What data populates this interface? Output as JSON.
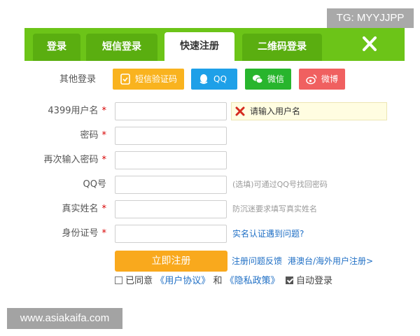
{
  "watermarks": {
    "top": "TG: MYYJJPP",
    "bottom": "www.asiakaifa.com"
  },
  "tabs": [
    {
      "label": "登录",
      "active": false
    },
    {
      "label": "短信登录",
      "active": false
    },
    {
      "label": "快速注册",
      "active": true
    },
    {
      "label": "二维码登录",
      "active": false
    }
  ],
  "close_icon": "close-icon",
  "other_login": {
    "label": "其他登录",
    "buttons": [
      {
        "label": "短信验证码",
        "color": "#f9b31f",
        "icon": "sms-icon"
      },
      {
        "label": "QQ",
        "color": "#1ea0e8",
        "icon": "qq-icon"
      },
      {
        "label": "微信",
        "color": "#28b52d",
        "icon": "wechat-icon"
      },
      {
        "label": "微博",
        "color": "#f06060",
        "icon": "weibo-icon"
      }
    ]
  },
  "form": {
    "username": {
      "label": "4399用户名",
      "required_mark": "*",
      "value": "",
      "error": "请输入用户名"
    },
    "password": {
      "label": "密码",
      "required_mark": "*",
      "value": ""
    },
    "password_confirm": {
      "label": "再次输入密码",
      "required_mark": "*",
      "value": ""
    },
    "qq": {
      "label": "QQ号",
      "value": "",
      "hint": "(选填)可通过QQ号找回密码"
    },
    "real_name": {
      "label": "真实姓名",
      "required_mark": "*",
      "value": "",
      "hint": "防沉迷要求填写真实姓名"
    },
    "id_number": {
      "label": "身份证号",
      "required_mark": "*",
      "value": "",
      "hint": "实名认证遇到问题?"
    }
  },
  "submit_label": "立即注册",
  "links": {
    "feedback": "注册问题反馈",
    "overseas": "港澳台/海外用户注册>"
  },
  "agreement": {
    "prefix": "已同意",
    "user_agreement": "《用户协议》",
    "and": "和",
    "privacy": "《隐私政策》",
    "agreed": false,
    "auto_login_label": "自动登录",
    "auto_login": true
  },
  "colors": {
    "tabbar": "#6cc418",
    "submit": "#f9a91d",
    "link": "#1f6fc5",
    "required": "#d80000"
  }
}
